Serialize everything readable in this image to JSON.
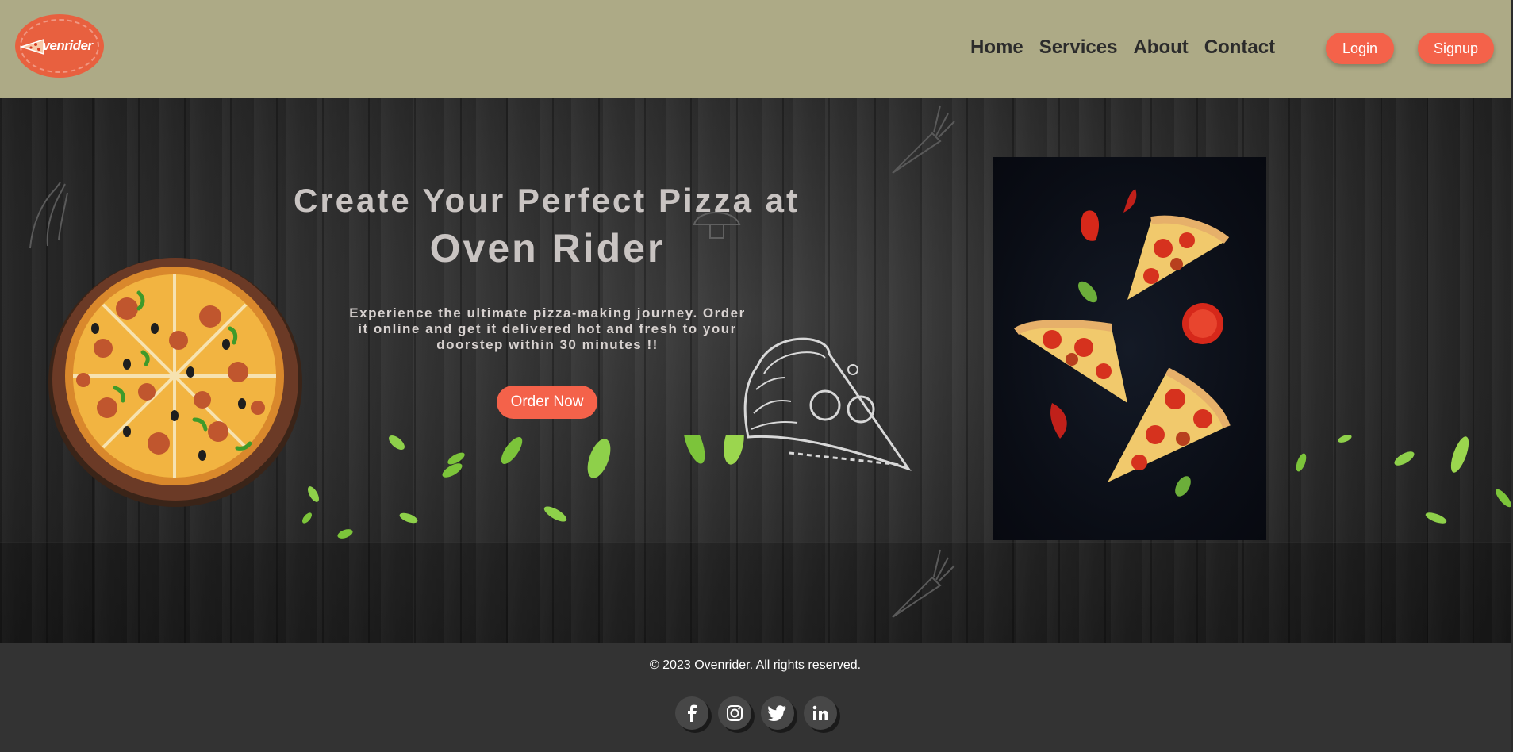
{
  "header": {
    "logo_text": "venrider",
    "nav": [
      "Home",
      "Services",
      "About",
      "Contact"
    ],
    "login_label": "Login",
    "signup_label": "Signup"
  },
  "hero": {
    "headline_line1": "Create Your Perfect Pizza at",
    "headline_line2": "Oven Rider",
    "tagline": "Experience the ultimate pizza-making journey. Order it online and get it delivered hot and fresh to your doorstep within 30 minutes !!",
    "order_button": "Order Now"
  },
  "footer": {
    "copyright": "© 2023 Ovenrider. All rights reserved.",
    "socials": [
      "facebook-icon",
      "instagram-icon",
      "twitter-icon",
      "linkedin-icon"
    ]
  },
  "colors": {
    "header_bg": "#adaa86",
    "accent": "#f4624a",
    "footer_bg": "#333333"
  }
}
